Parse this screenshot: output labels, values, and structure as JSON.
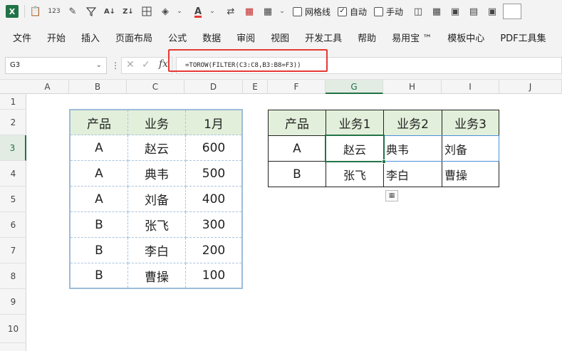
{
  "toolbar": {
    "checkboxes": [
      {
        "label": "网格线",
        "checked": false
      },
      {
        "label": "自动",
        "checked": true
      },
      {
        "label": "手动",
        "checked": false
      }
    ]
  },
  "menu": [
    "文件",
    "开始",
    "插入",
    "页面布局",
    "公式",
    "数据",
    "审阅",
    "视图",
    "开发工具",
    "帮助",
    "易用宝 ™",
    "模板中心",
    "PDF工具集"
  ],
  "formula_bar": {
    "name_box": "G3",
    "fx": "fx",
    "formula": "=TOROW(FILTER(C3:C8,B3:B8=F3))"
  },
  "columns": [
    "A",
    "B",
    "C",
    "D",
    "E",
    "F",
    "G",
    "H",
    "I",
    "J"
  ],
  "rows": [
    "1",
    "2",
    "3",
    "4",
    "5",
    "6",
    "7",
    "8",
    "9",
    "10"
  ],
  "left_table": {
    "headers": [
      "产品",
      "业务",
      "1月"
    ],
    "rows": [
      [
        "A",
        "赵云",
        "600"
      ],
      [
        "A",
        "典韦",
        "500"
      ],
      [
        "A",
        "刘备",
        "400"
      ],
      [
        "B",
        "张飞",
        "300"
      ],
      [
        "B",
        "李白",
        "200"
      ],
      [
        "B",
        "曹操",
        "100"
      ]
    ]
  },
  "right_table": {
    "headers": [
      "产品",
      "业务1",
      "业务2",
      "业务3"
    ],
    "rows": [
      [
        "A",
        "赵云",
        "典韦",
        "刘备"
      ],
      [
        "B",
        "张飞",
        "李白",
        "曹操"
      ]
    ]
  },
  "colors": {
    "accent": "#217346",
    "highlight": "#e53935",
    "header_fill": "#e2efda"
  }
}
